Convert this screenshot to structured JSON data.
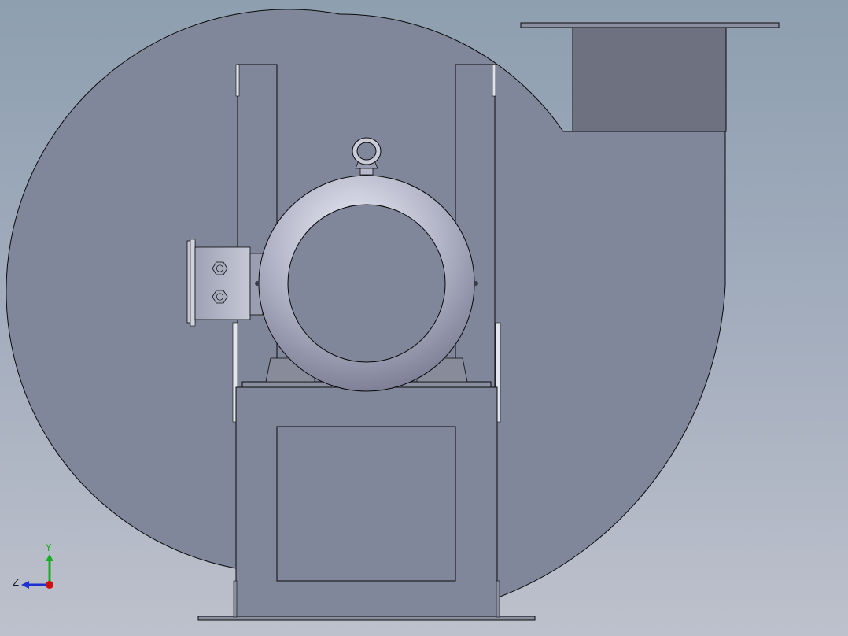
{
  "viewport": {
    "background_top": "#8e9fb0",
    "background_bottom": "#bdc1cc"
  },
  "model": {
    "housing_color": "#80879a",
    "duct_color": "#6e7280",
    "motor_color": "#b4b6c8",
    "outline_color": "#0a0a0a"
  },
  "triad": {
    "y_label": "Y",
    "z_label": "Z",
    "y_color": "#18b020",
    "z_color": "#2030d0",
    "x_color": "#d01010"
  }
}
